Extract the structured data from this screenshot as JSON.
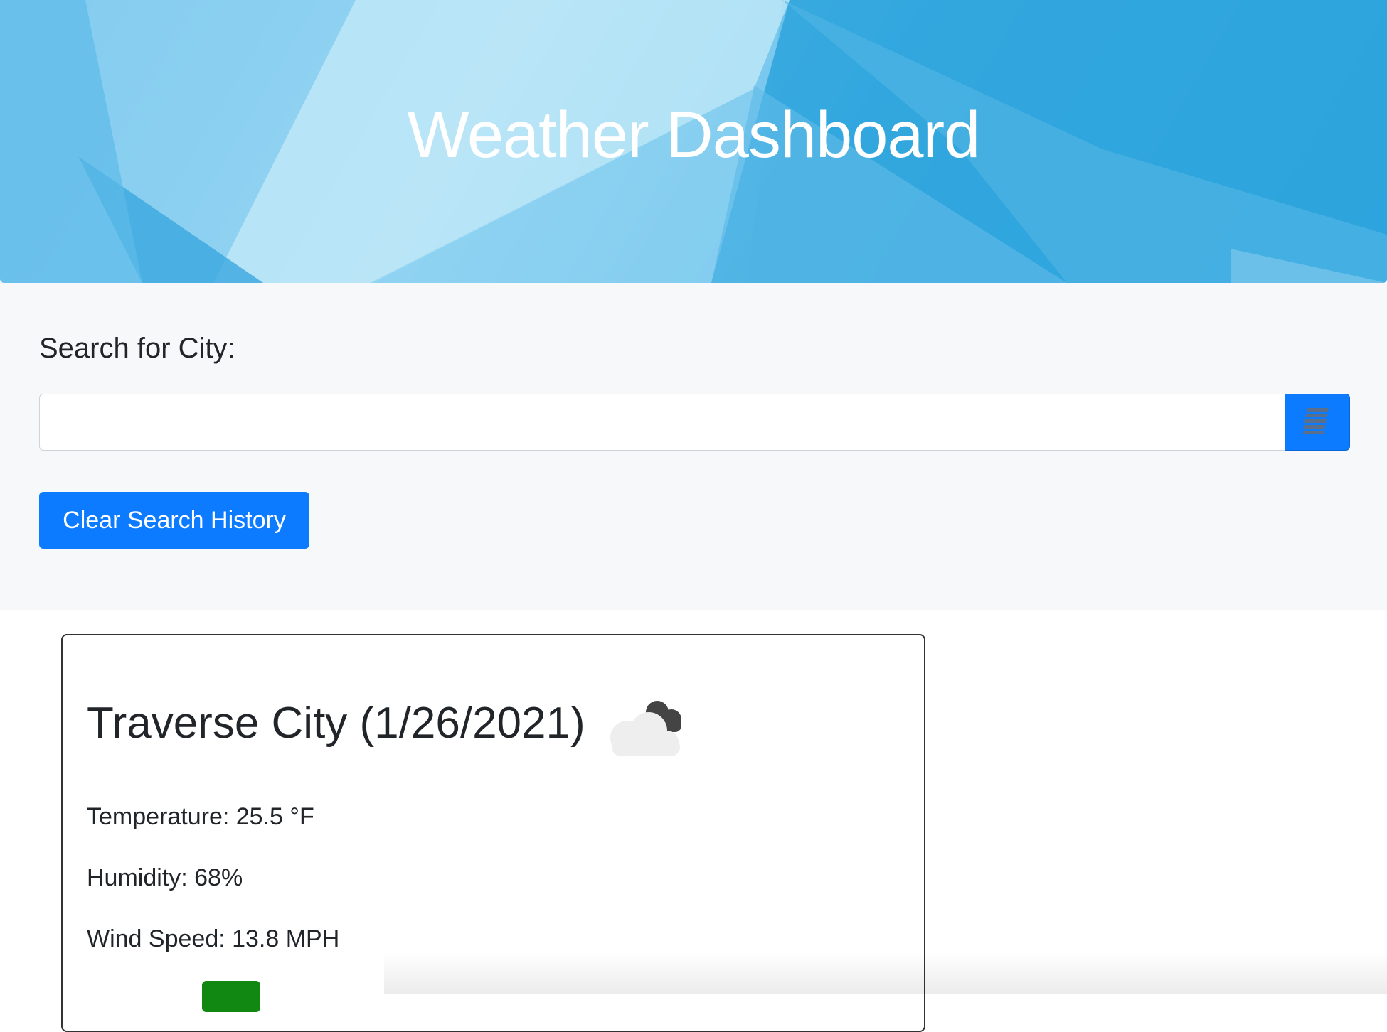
{
  "header": {
    "title": "Weather Dashboard"
  },
  "search": {
    "label": "Search for City:",
    "input_value": "",
    "input_placeholder": "",
    "button_icon": "list-icon",
    "clear_label": "Clear Search History"
  },
  "current_weather": {
    "title": "Traverse City (1/26/2021)",
    "icon": "broken-clouds-icon",
    "temperature": "Temperature: 25.5 °F",
    "humidity": "Humidity: 68%",
    "wind_speed": "Wind Speed: 13.8 MPH",
    "uv_color": "#118811"
  },
  "colors": {
    "primary": "#0d7bff",
    "hero_blue": "#2a9fdb",
    "panel_bg": "#f7f8fa"
  }
}
